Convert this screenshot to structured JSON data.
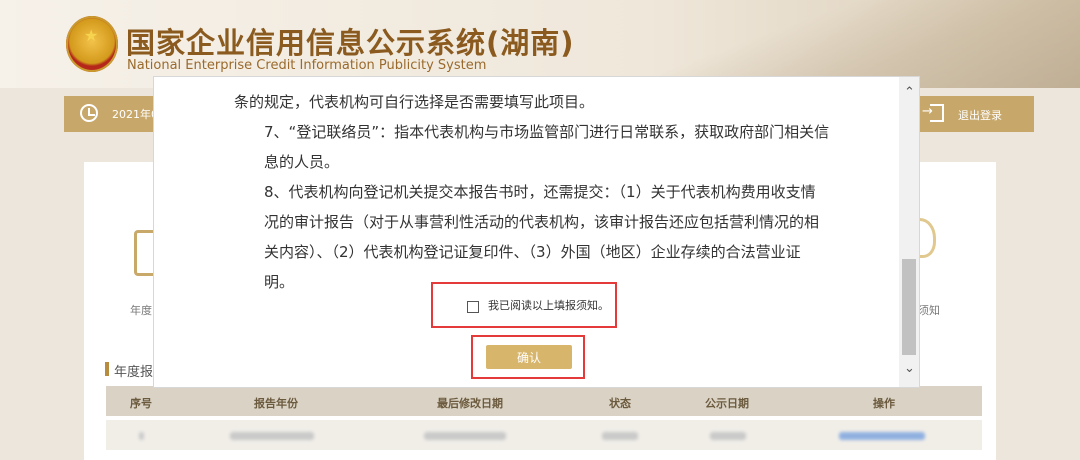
{
  "header": {
    "title": "国家企业信用信息公示系统(湖南)",
    "subtitle": "National Enterprise Credit Information Publicity System"
  },
  "topbar": {
    "date": "2021年0",
    "logout_label": "退出登录"
  },
  "background": {
    "left_tile_label": "年度",
    "right_tile_label": "须知",
    "section_title": "年度报",
    "table": {
      "headers": [
        "序号",
        "报告年份",
        "最后修改日期",
        "状态",
        "公示日期",
        "操作"
      ]
    }
  },
  "modal": {
    "paragraphs": [
      "条的规定，代表机构可自行选择是否需要填写此项目。",
      "7、“登记联络员”：指本代表机构与市场监管部门进行日常联系，获取政府部门相关信息的人员。",
      "8、代表机构向登记机关提交本报告书时，还需提交：（1）关于代表机构费用收支情况的审计报告（对于从事营利性活动的代表机构，该审计报告还应包括营利情况的相关内容）、（2）代表机构登记证复印件、（3）外国（地区）企业存续的合法营业证明。"
    ],
    "checkbox_label": "我已阅读以上填报须知。",
    "confirm_label": "确认"
  }
}
